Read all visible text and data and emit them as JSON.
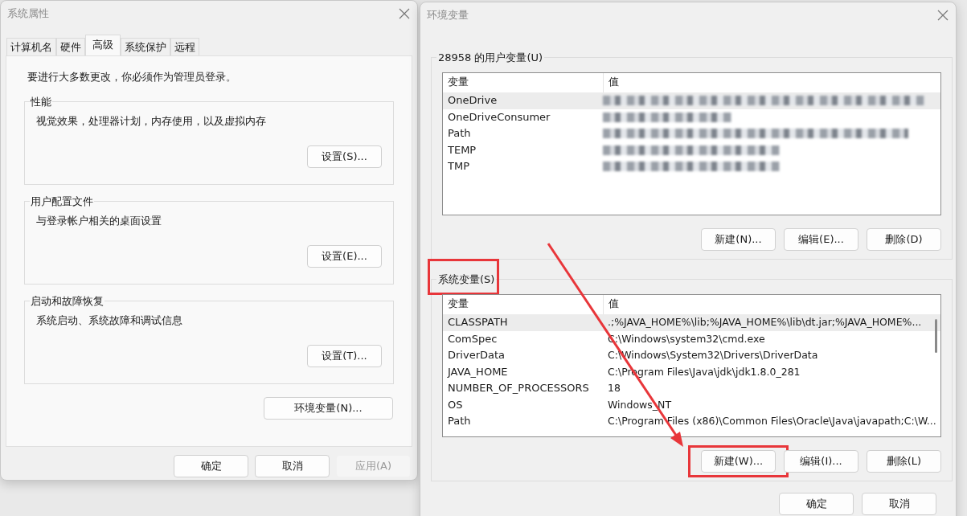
{
  "system_properties": {
    "title": "系统属性",
    "tabs": [
      {
        "label": "计算机名",
        "selected": false
      },
      {
        "label": "硬件",
        "selected": false
      },
      {
        "label": "高级",
        "selected": true
      },
      {
        "label": "系统保护",
        "selected": false
      },
      {
        "label": "远程",
        "selected": false
      }
    ],
    "notice": "要进行大多数更改，你必须作为管理员登录。",
    "groups": [
      {
        "title": "性能",
        "description": "视觉效果，处理器计划，内存使用，以及虚拟内存",
        "button": "设置(S)..."
      },
      {
        "title": "用户配置文件",
        "description": "与登录帐户相关的桌面设置",
        "button": "设置(E)..."
      },
      {
        "title": "启动和故障恢复",
        "description": "系统启动、系统故障和调试信息",
        "button": "设置(T)..."
      }
    ],
    "env_button": "环境变量(N)...",
    "buttons": [
      {
        "label": "确定",
        "disabled": false
      },
      {
        "label": "取消",
        "disabled": false
      },
      {
        "label": "应用(A)",
        "disabled": true
      }
    ]
  },
  "environment_variables": {
    "title": "环境变量",
    "user_vars": {
      "title": "28958 的用户变量(U)",
      "highlighted": false,
      "columns": [
        "变量",
        "值"
      ],
      "rows": [
        {
          "name": "OneDrive",
          "blurred": true,
          "selected": true
        },
        {
          "name": "OneDriveConsumer",
          "blurred": true,
          "selected": false
        },
        {
          "name": "Path",
          "blurred": true,
          "selected": false
        },
        {
          "name": "TEMP",
          "blurred": true,
          "selected": false
        },
        {
          "name": "TMP",
          "blurred": true,
          "selected": false
        }
      ],
      "buttons": [
        {
          "label": "新建(N)...",
          "highlighted": false
        },
        {
          "label": "编辑(E)...",
          "highlighted": false
        },
        {
          "label": "删除(D)",
          "highlighted": false
        }
      ]
    },
    "system_vars": {
      "title": "系统变量(S)",
      "highlighted": true,
      "columns": [
        "变量",
        "值"
      ],
      "rows": [
        {
          "name": "CLASSPATH",
          "value": ".;%JAVA_HOME%\\lib;%JAVA_HOME%\\lib\\dt.jar;%JAVA_HOME%...",
          "selected": true
        },
        {
          "name": "ComSpec",
          "value": "C:\\Windows\\system32\\cmd.exe",
          "selected": false
        },
        {
          "name": "DriverData",
          "value": "C:\\Windows\\System32\\Drivers\\DriverData",
          "selected": false
        },
        {
          "name": "JAVA_HOME",
          "value": "C:\\Program Files\\Java\\jdk\\jdk1.8.0_281",
          "selected": false
        },
        {
          "name": "NUMBER_OF_PROCESSORS",
          "value": "18",
          "selected": false
        },
        {
          "name": "OS",
          "value": "Windows_NT",
          "selected": false
        },
        {
          "name": "Path",
          "value": "C:\\Program Files (x86)\\Common Files\\Oracle\\Java\\javapath;C:\\W...",
          "selected": false
        }
      ],
      "buttons": [
        {
          "label": "新建(W)...",
          "highlighted": true
        },
        {
          "label": "编辑(I)...",
          "highlighted": false
        },
        {
          "label": "删除(L)",
          "highlighted": false
        }
      ]
    },
    "buttons": [
      {
        "label": "确定"
      },
      {
        "label": "取消"
      }
    ]
  },
  "annotation_arrow": true
}
